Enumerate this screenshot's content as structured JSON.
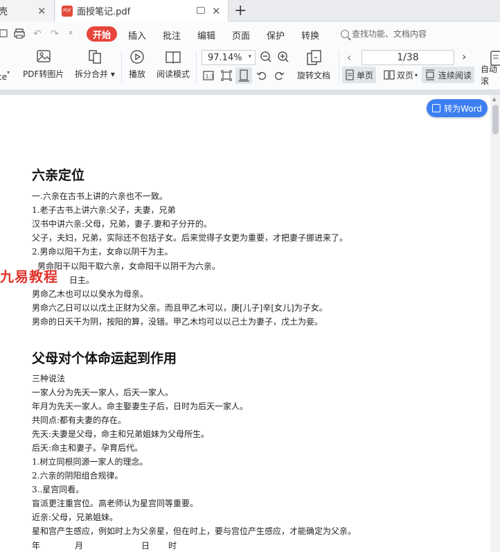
{
  "tabs": {
    "prev_fragment": "壳",
    "active_title": "面授笔记.pdf",
    "pdf_badge": "PDF"
  },
  "menu": {
    "start": "开始",
    "insert": "插入",
    "annotate": "批注",
    "edit": "编辑",
    "page": "页面",
    "protect": "保护",
    "convert": "转换",
    "search_placeholder": "查找功能、文档内容"
  },
  "toolbar": {
    "first_fragment": "ce",
    "pdf_to_image": "PDF转图片",
    "split_merge": "拆分合并",
    "play": "播放",
    "reading_mode": "阅读模式",
    "zoom": "97.14%",
    "page_indicator": "1/38",
    "rotate_doc": "旋转文档",
    "single_page": "单页",
    "double_page": "双页",
    "continuous": "连续阅读",
    "auto_scroll": "自动滚"
  },
  "convert_word": "转为Word",
  "watermark": "九易教程",
  "doc": {
    "section1_title": "六亲定位",
    "section1_lines": [
      "一.六亲在古书上讲的六亲也不一致。",
      "1.老子古书上讲六亲:父子，夫妻，兄弟",
      "汉书中讲六亲:父母，兄弟，妻子.妻和子分开的。",
      "父子，夫妇，兄弟，实际还不包括子女。后来觉得子女更为重要，才把妻子挪进来了。",
      "2.男命以阳干为主，女命以阴干为主。",
      "男命阳干以阳干取六亲，女命阳干以阴干为六亲。",
      "日主。",
      "男命乙木也可以以癸水为母亲。",
      "男命六乙日可以以戊土正财为父亲。而且甲乙木可以，庚[儿子]辛[女儿]为子女。",
      "男命的日天干为阴，按阳的算，没错。甲乙木均可以以己土为妻子，戊土为妾。"
    ],
    "section2_title": "父母对个体命运起到作用",
    "section2_lines": [
      "三种说法",
      "一家人分为先天一家人，后天一家人。",
      "年月为先天一家人。命主娶妻生子后，日时为后天一家人。",
      "共同点:都有夫妻的存在。",
      "先天:夫妻是父母，命主和兄弟姐妹为父母所生。",
      "后天:命主和妻子。孕育后代。",
      "1.树立同根同源一家人的理念。",
      "2.六亲的阴阳组合规律。",
      "3..星宫同看。",
      "盲派更注重宫位。高老师认为星宫同等重要。",
      "近亲:父母，兄弟姐妹。",
      "星和宫产生感应，例如时上为父亲星，但在时上，要与宫位产生感应，才能确定为父亲。"
    ],
    "table_header": [
      "年",
      "月",
      "日",
      "时"
    ]
  }
}
